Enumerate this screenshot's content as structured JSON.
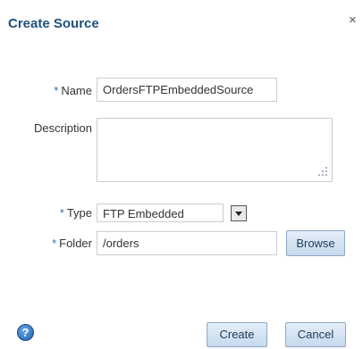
{
  "dialog": {
    "title": "Create Source",
    "close_glyph": "×"
  },
  "form": {
    "required_marker": "*",
    "name_label": "Name",
    "name_value": "OrdersFTPEmbeddedSource",
    "description_label": "Description",
    "description_value": "",
    "type_label": "Type",
    "type_value": "FTP Embedded",
    "folder_label": "Folder",
    "folder_value": "/orders",
    "browse_label": "Browse"
  },
  "footer": {
    "help_glyph": "?",
    "create_label": "Create",
    "cancel_label": "Cancel"
  },
  "colors": {
    "title": "#20517e",
    "required_marker": "#3b6fa0",
    "button_bg": "#c6d9ec",
    "field_border": "#c7ced6"
  },
  "icons": {
    "close": "close-icon",
    "help": "help-icon",
    "dropdown": "chevron-down-icon",
    "resize": "resize-grip-icon"
  }
}
